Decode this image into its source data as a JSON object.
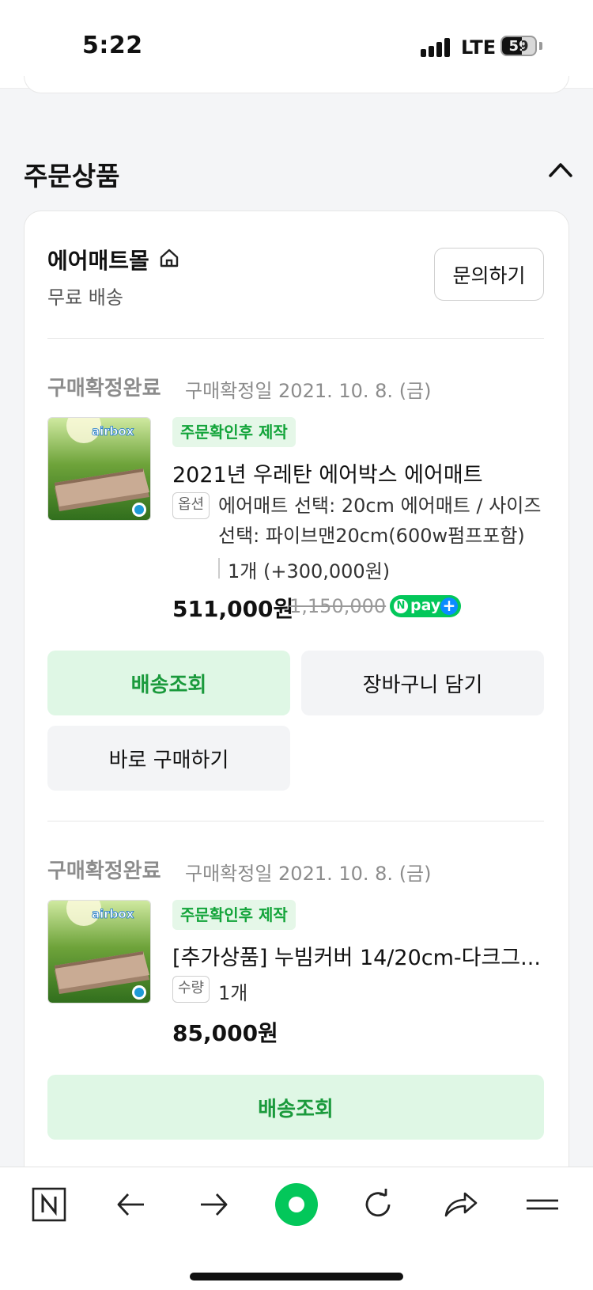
{
  "status_bar": {
    "time": "5:22",
    "network": "LTE",
    "battery": "59"
  },
  "section": {
    "title": "주문상품"
  },
  "store": {
    "name": "에어매트몰",
    "shipping": "무료 배송",
    "inquiry_label": "문의하기"
  },
  "orders": [
    {
      "status": "구매확정완료",
      "date": "구매확정일 2021. 10. 8. (금)",
      "thumb_brand": "airbox",
      "badge": "주문확인후 제작",
      "name": "2021년 우레탄 에어박스 에어매트",
      "option_tag": "옵션",
      "option_line1": "에어매트 선택: 20cm 에어매트 / 사이즈",
      "option_line2": "선택: 파이브맨20cm(600w펌프포함)",
      "option_qty": "1개 (+300,000원)",
      "price": "511,000원",
      "original_price": "1,150,000",
      "npay_label": "pay",
      "buttons": {
        "track": "배송조회",
        "cart": "장바구니 담기",
        "buy": "바로 구매하기"
      }
    },
    {
      "status": "구매확정완료",
      "date": "구매확정일 2021. 10. 8. (금)",
      "thumb_brand": "airbox",
      "badge": "주문확인후 제작",
      "name": "[추가상품] 누빔커버 14/20cm-다크그...",
      "option_tag": "수량",
      "option_qty": "1개",
      "price": "85,000원",
      "buttons": {
        "track": "배송조회"
      }
    }
  ],
  "nav": {
    "icons": [
      "naver-n-icon",
      "back-arrow-icon",
      "forward-arrow-icon",
      "green-circle-icon",
      "refresh-icon",
      "share-icon",
      "menu-icon"
    ],
    "accent": "#03c75a"
  }
}
